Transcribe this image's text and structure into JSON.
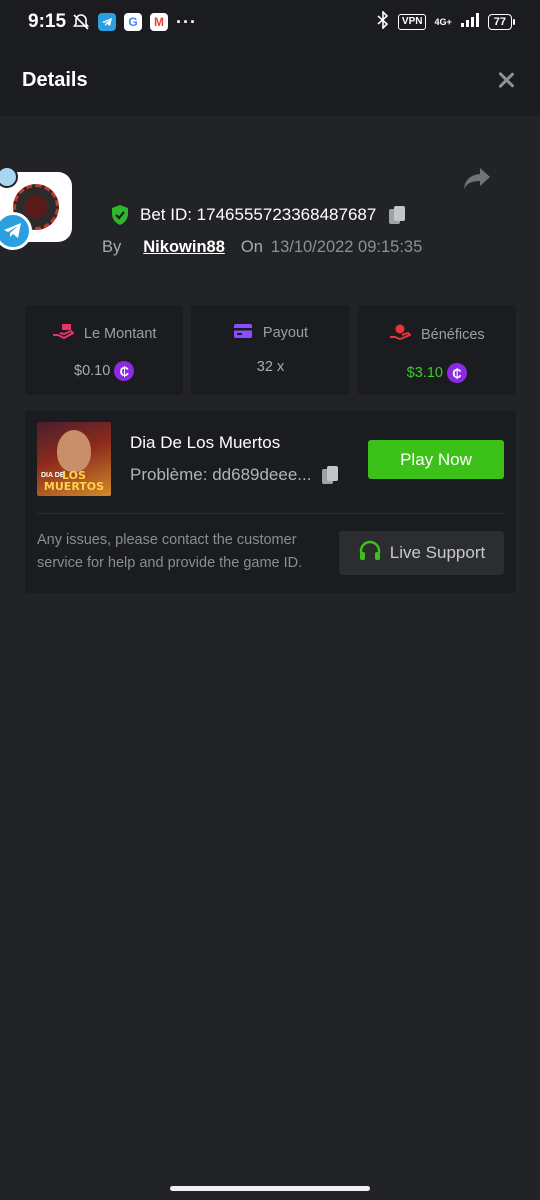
{
  "status_bar": {
    "time": "9:15",
    "vpn_label": "VPN",
    "network": "4G+",
    "battery": "77",
    "more": "···",
    "apps": [
      "telegram-icon",
      "google-icon",
      "gmail-icon"
    ]
  },
  "header": {
    "title": "Details"
  },
  "bet": {
    "id_label": "Bet ID: 1746555723368487687",
    "by_label": "By",
    "username": "Nikowin88",
    "on_label": "On",
    "date": "13/10/2022 09:15:35"
  },
  "stats": [
    {
      "label": "Le Montant",
      "value": "$0.10",
      "icon": "money-hand-icon",
      "color": "#e8336b"
    },
    {
      "label": "Payout",
      "value": "32 x",
      "icon": "card-icon",
      "color": "#8b4dff"
    },
    {
      "label": "Bénéfices",
      "value": "$3.10",
      "icon": "profit-hand-icon",
      "color": "#e6343a"
    }
  ],
  "coin_symbol": "₵",
  "game": {
    "name": "Dia De Los Muertos",
    "problem": "Problème: dd689deee...",
    "thumb_title": "LOS MUERTOS",
    "thumb_sub": "DIA DE",
    "play_label": "Play Now",
    "help_text": "Any issues, please contact the customer service for help and provide the game ID.",
    "support_label": "Live Support"
  },
  "colors": {
    "accent_green": "#3bc117",
    "profit_green": "#3ec92e",
    "coin_purple": "#8a2be2",
    "background": "#222326",
    "panel": "#1b1c1f"
  }
}
